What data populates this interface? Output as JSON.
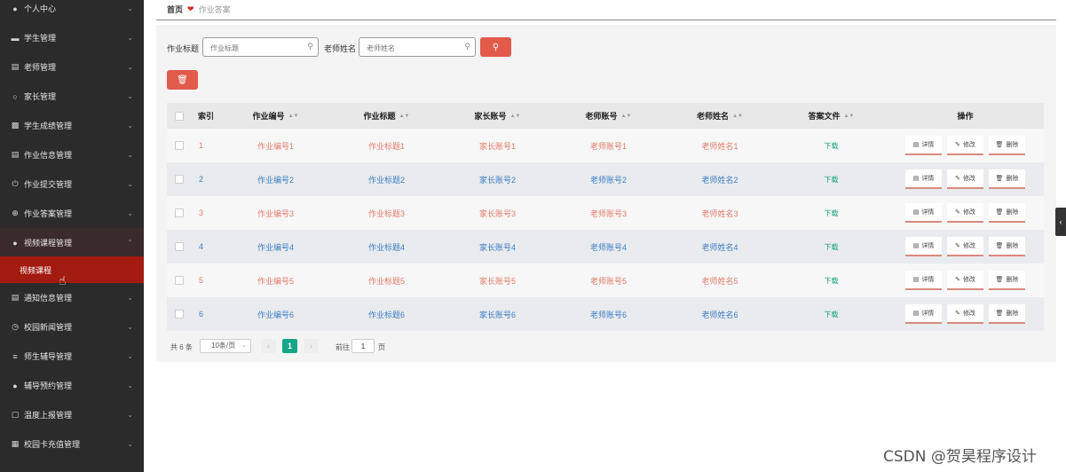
{
  "sidebar": {
    "items": [
      {
        "label": "个人中心",
        "icon": "user-icon"
      },
      {
        "label": "学生管理",
        "icon": "hat-icon"
      },
      {
        "label": "老师管理",
        "icon": "chart-icon"
      },
      {
        "label": "家长管理",
        "icon": "compass-icon"
      },
      {
        "label": "学生成绩管理",
        "icon": "bar-chart-icon"
      },
      {
        "label": "作业信息管理",
        "icon": "message-icon"
      },
      {
        "label": "作业提交管理",
        "icon": "power-icon"
      },
      {
        "label": "作业答案管理",
        "icon": "target-icon"
      },
      {
        "label": "视频课程管理",
        "icon": "user-icon"
      },
      {
        "label": "通知信息管理",
        "icon": "bank-icon"
      },
      {
        "label": "校园新闻管理",
        "icon": "clock-icon"
      },
      {
        "label": "师生辅导管理",
        "icon": "sliders-icon"
      },
      {
        "label": "辅导预约管理",
        "icon": "user-icon"
      },
      {
        "label": "温度上报管理",
        "icon": "scan-icon"
      },
      {
        "label": "校园卡充值管理",
        "icon": "grid-icon"
      },
      {
        "label": "",
        "icon": "more-icon"
      }
    ],
    "active_sub": "视频课程"
  },
  "breadcrumb": {
    "home": "首页",
    "current": "作业答案"
  },
  "search": {
    "title_label": "作业标题",
    "title_placeholder": "作业标题",
    "teacher_label": "老师姓名",
    "teacher_placeholder": "老师姓名"
  },
  "table": {
    "headers": {
      "index": "索引",
      "hw_no": "作业编号",
      "hw_title": "作业标题",
      "parent_acct": "家长账号",
      "teacher_acct": "老师账号",
      "teacher_name": "老师姓名",
      "answer_file": "答案文件",
      "ops": "操作"
    },
    "rows": [
      {
        "index": "1",
        "hw_no": "作业编号1",
        "hw_title": "作业标题1",
        "parent_acct": "家长账号1",
        "teacher_acct": "老师账号1",
        "teacher_name": "老师姓名1",
        "file": "下载"
      },
      {
        "index": "2",
        "hw_no": "作业编号2",
        "hw_title": "作业标题2",
        "parent_acct": "家长账号2",
        "teacher_acct": "老师账号2",
        "teacher_name": "老师姓名2",
        "file": "下载"
      },
      {
        "index": "3",
        "hw_no": "作业编号3",
        "hw_title": "作业标题3",
        "parent_acct": "家长账号3",
        "teacher_acct": "老师账号3",
        "teacher_name": "老师姓名3",
        "file": "下载"
      },
      {
        "index": "4",
        "hw_no": "作业编号4",
        "hw_title": "作业标题4",
        "parent_acct": "家长账号4",
        "teacher_acct": "老师账号4",
        "teacher_name": "老师姓名4",
        "file": "下载"
      },
      {
        "index": "5",
        "hw_no": "作业编号5",
        "hw_title": "作业标题5",
        "parent_acct": "家长账号5",
        "teacher_acct": "老师账号5",
        "teacher_name": "老师姓名5",
        "file": "下载"
      },
      {
        "index": "6",
        "hw_no": "作业编号6",
        "hw_title": "作业标题6",
        "parent_acct": "家长账号6",
        "teacher_acct": "老师账号6",
        "teacher_name": "老师姓名6",
        "file": "下载"
      }
    ],
    "actions": {
      "detail": "详情",
      "edit": "修改",
      "delete": "删除"
    }
  },
  "pager": {
    "total": "共 6 条",
    "page_size": "10条/页",
    "current": "1",
    "goto_label": "前往",
    "goto_value": "1",
    "page_suffix": "页"
  },
  "watermark": "CSDN @贺昊程序设计",
  "colors": {
    "sidebar_bg": "#2b2b2b",
    "active_bg": "#a31a10",
    "accent_red": "#e15a4a",
    "link_odd": "#e07b6a",
    "link_even": "#3d7dc2",
    "download": "#14a07a",
    "pager_active": "#17a589"
  }
}
